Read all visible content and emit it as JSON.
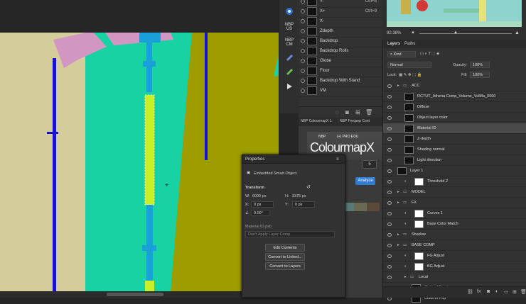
{
  "channels": [
    {
      "label": "Y-",
      "key": "Ctrl+8"
    },
    {
      "label": "X+",
      "key": "Ctrl+9"
    },
    {
      "label": "X-",
      "key": ""
    },
    {
      "label": "Zdepth",
      "key": ""
    },
    {
      "label": "Backdrop",
      "key": ""
    },
    {
      "label": "Backdrop Rolls",
      "key": ""
    },
    {
      "label": "Globe",
      "key": ""
    },
    {
      "label": "Floor",
      "key": ""
    },
    {
      "label": "Backdrop With Stand",
      "key": ""
    },
    {
      "label": "VM",
      "key": ""
    }
  ],
  "toolstrip": {
    "nbp_us": "NBP\nUS",
    "nbp_cm": "NBP\nCM"
  },
  "colourmap": {
    "tab1": "NBP ColourmapX 1",
    "tab2": "NBP Freqsep Cont",
    "logo_small": "NBP",
    "logo_edu": "(+) PRO EDU",
    "logo_big": "ColourmapX",
    "number": "5",
    "analyze": "Analyze",
    "swatches": [
      "#5a7a78",
      "#6a6a52",
      "#5b4a3a",
      "#3d5b6a",
      "#4c4c4c"
    ]
  },
  "properties": {
    "title": "Properties",
    "object_type": "Embedded Smart Object",
    "transform_label": "Transform",
    "w_label": "W:",
    "w_value": "6000 px",
    "h_label": "H:",
    "h_value": "3375 px",
    "x_label": "X:",
    "x_value": "0 px",
    "y_label": "Y:",
    "y_value": "0 px",
    "angle_value": "0.00°",
    "file_name": "Material ID.psb",
    "layer_comp": "Don't Apply Layer Comp",
    "btn_edit": "Edit Contents",
    "btn_convert_linked": "Convert to Linked...",
    "btn_convert_layers": "Convert to Layers"
  },
  "navigator": {
    "zoom": "92.38%"
  },
  "layers_panel": {
    "tab_layers": "Layers",
    "tab_paths": "Paths",
    "kind_label": "Kind",
    "blend_mode": "Normal",
    "opacity_label": "Opacity:",
    "opacity_value": "100%",
    "lock_label": "Lock:",
    "fill_label": "Fill:",
    "fill_value": "100%"
  },
  "layers": [
    {
      "name": "ACC",
      "indent": 0,
      "type": "group"
    },
    {
      "name": "RCTUT_Athena Comp_Volume_VolMa_0000",
      "indent": 1,
      "type": "layer"
    },
    {
      "name": "Diffuse",
      "indent": 1,
      "type": "layer"
    },
    {
      "name": "Object layer color",
      "indent": 1,
      "type": "layer"
    },
    {
      "name": "Material ID",
      "indent": 1,
      "type": "layer",
      "selected": true
    },
    {
      "name": "Z-depth",
      "indent": 1,
      "type": "layer"
    },
    {
      "name": "Shading normal",
      "indent": 1,
      "type": "layer"
    },
    {
      "name": "Light direction",
      "indent": 1,
      "type": "layer"
    },
    {
      "name": "Layer 1",
      "indent": 0,
      "type": "layer"
    },
    {
      "name": "Threshold 2",
      "indent": 1,
      "type": "adjust"
    },
    {
      "name": "MODEL",
      "indent": 0,
      "type": "group"
    },
    {
      "name": "FX",
      "indent": 0,
      "type": "group"
    },
    {
      "name": "Curves 1",
      "indent": 1,
      "type": "adjust"
    },
    {
      "name": "Base Color Match",
      "indent": 1,
      "type": "adjust"
    },
    {
      "name": "Shadow",
      "indent": 0,
      "type": "group"
    },
    {
      "name": "BASE COMP",
      "indent": 0,
      "type": "group"
    },
    {
      "name": "FG Adjust",
      "indent": 1,
      "type": "adjust"
    },
    {
      "name": "BG Adjust",
      "indent": 1,
      "type": "adjust"
    },
    {
      "name": "Local",
      "indent": 1,
      "type": "group"
    },
    {
      "name": "C stand Front",
      "indent": 2,
      "type": "layer"
    },
    {
      "name": "Column Pop",
      "indent": 2,
      "type": "layer"
    }
  ],
  "colors": {
    "canvas_teal": "#19d2a4",
    "olive": "#9d9d00",
    "blue": "#1414d0",
    "lime": "#c8f02a",
    "beige": "#d4cc9a",
    "pink": "#d196c2",
    "accent_blue": "#2f7bd6"
  }
}
